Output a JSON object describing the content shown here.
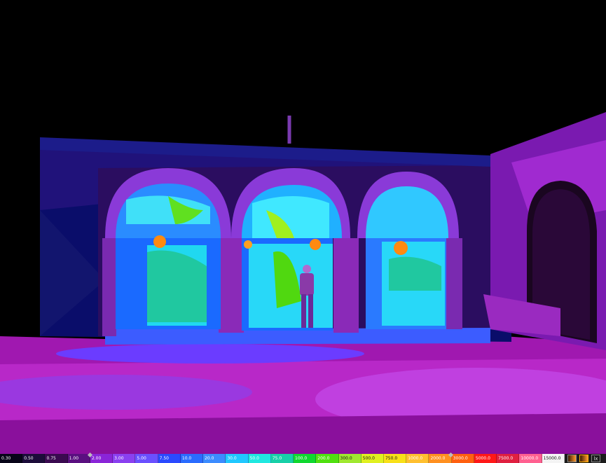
{
  "legend": {
    "segments": [
      {
        "label": "0.30",
        "color": "#070418"
      },
      {
        "label": "0.50",
        "color": "#1c0c3a"
      },
      {
        "label": "0.75",
        "color": "#3a0a50"
      },
      {
        "label": "1.00",
        "color": "#5a1080"
      },
      {
        "label": "2.00",
        "color": "#8a25d8"
      },
      {
        "label": "3.00",
        "color": "#8a40f0"
      },
      {
        "label": "5.00",
        "color": "#6a50ff"
      },
      {
        "label": "7.50",
        "color": "#2a4aff"
      },
      {
        "label": "10.0",
        "color": "#2a6cff"
      },
      {
        "label": "20.0",
        "color": "#3c8cff"
      },
      {
        "label": "30.0",
        "color": "#20c8ff"
      },
      {
        "label": "50.0",
        "color": "#20e8e0"
      },
      {
        "label": "75.0",
        "color": "#18d0a8"
      },
      {
        "label": "100.0",
        "color": "#10d830"
      },
      {
        "label": "200.0",
        "color": "#50e010"
      },
      {
        "label": "300.0",
        "color": "#a0e830"
      },
      {
        "label": "500.0",
        "color": "#e0f020"
      },
      {
        "label": "750.0",
        "color": "#f8e018"
      },
      {
        "label": "1000.0",
        "color": "#ffc030"
      },
      {
        "label": "2000.0",
        "color": "#ff9020"
      },
      {
        "label": "3000.0",
        "color": "#ff6010"
      },
      {
        "label": "5000.0",
        "color": "#ff1818"
      },
      {
        "label": "7500.0",
        "color": "#e02040"
      },
      {
        "label": "10000.0",
        "color": "#ff6090"
      },
      {
        "label": "15000.0",
        "color": "#f4f4f4"
      }
    ],
    "markers": [
      {
        "segment": 3
      },
      {
        "segment": 19
      }
    ],
    "tools": [
      {
        "name": "gradient-tool",
        "label": ""
      },
      {
        "name": "palette-tool",
        "label": ""
      },
      {
        "name": "lux-tool",
        "label": "lx"
      }
    ]
  }
}
